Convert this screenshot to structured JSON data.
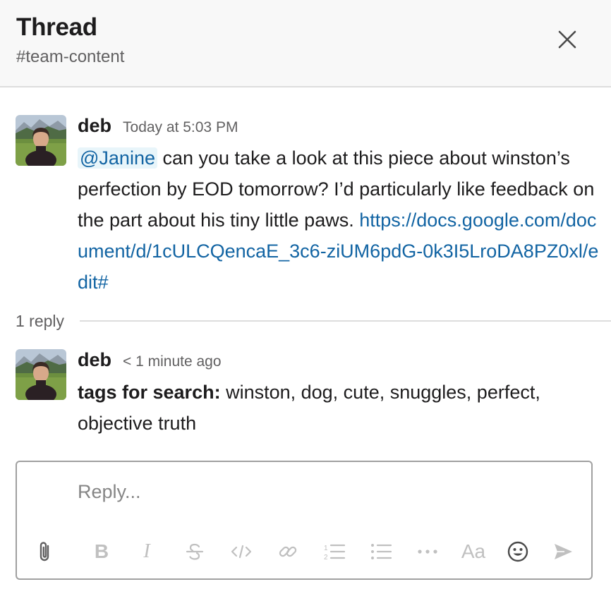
{
  "header": {
    "title": "Thread",
    "channel": "#team-content"
  },
  "parent_message": {
    "author": "deb",
    "timestamp": "Today at 5:03 PM",
    "mention": "@Janine",
    "text": " can you take a look at this piece about winston’s perfection by EOD tomorrow? I’d particularly like feedback on the part about his tiny little paws.",
    "link": "https://docs.google.com/document/d/1cULCQencaE_3c6-ziUM6pdG-0k3I5LroDA8PZ0xl/edit#"
  },
  "replies": {
    "count_label": "1 reply"
  },
  "reply_message": {
    "author": "deb",
    "timestamp": "< 1 minute ago",
    "bold_prefix": "tags for search:",
    "text": " winston, dog, cute, snuggles, perfect, objective truth"
  },
  "composer": {
    "placeholder": "Reply...",
    "toolbar": {
      "bold_label": "B",
      "italic_label": "I",
      "text_style_label": "Aa",
      "icons": [
        "paperclip-icon",
        "bold-icon",
        "italic-icon",
        "strikethrough-icon",
        "code-icon",
        "link-icon",
        "numbered-list-icon",
        "bulleted-list-icon",
        "more-icon",
        "text-style-icon",
        "emoji-icon",
        "send-icon"
      ]
    }
  },
  "colors": {
    "link": "#1264a3",
    "mention_bg": "#e8f5fa",
    "header_bg": "#f8f8f8",
    "muted_text": "#616061",
    "disabled_icon": "#c0c0c0"
  }
}
